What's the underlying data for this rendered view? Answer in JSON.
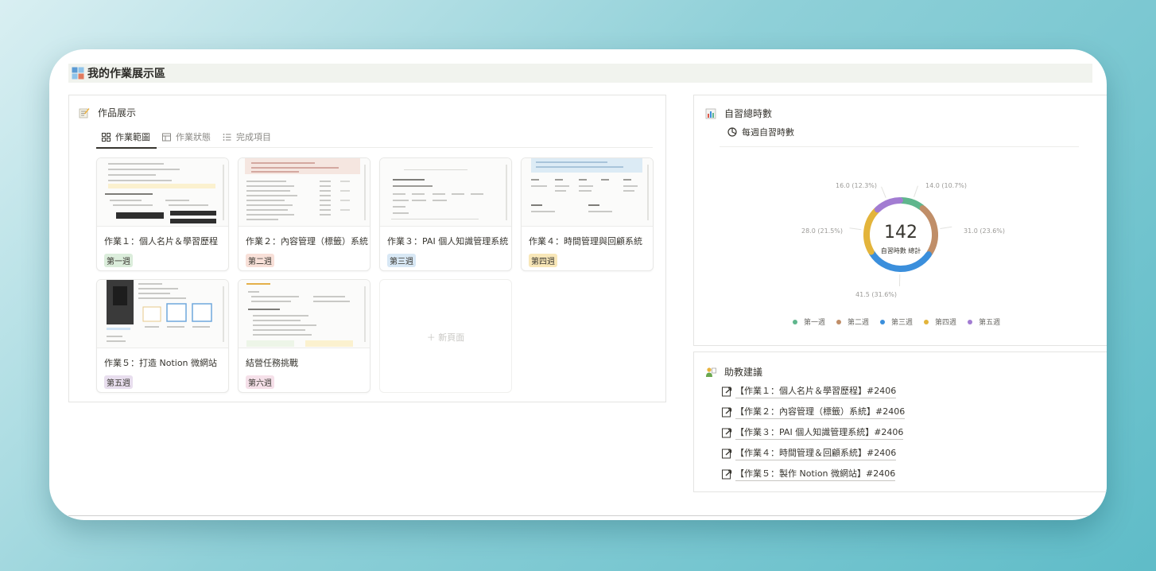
{
  "page": {
    "title": "我的作業展示區"
  },
  "works": {
    "title": "作品展示",
    "tabs": [
      {
        "label": "作業範圖",
        "active": true,
        "icon": "gallery-icon"
      },
      {
        "label": "作業狀態",
        "active": false,
        "icon": "table-icon"
      },
      {
        "label": "完成項目",
        "active": false,
        "icon": "list-icon"
      }
    ],
    "cards": [
      {
        "title": "作業１：個人名片＆學習歷程",
        "tag": "第一週",
        "tag_color": "#dbeddb"
      },
      {
        "title": "作業２：內容管理（標籤）系統",
        "tag": "第二週",
        "tag_color": "#f8e0d8"
      },
      {
        "title": "作業３：PAI 個人知識管理系統",
        "tag": "第三週",
        "tag_color": "#d8e8f5"
      },
      {
        "title": "作業４：時間管理與回顧系統",
        "tag": "第四週",
        "tag_color": "#f8e7b8"
      },
      {
        "title": "作業５：打造 Notion 微網站",
        "tag": "第五週",
        "tag_color": "#e8deee"
      },
      {
        "title": "結營任務挑戰",
        "tag": "第六週",
        "tag_color": "#f5e0e9"
      }
    ],
    "new_page": "＋ 新頁面"
  },
  "hours": {
    "title": "自習總時數",
    "subtab": "每週自習時數",
    "total": "142",
    "total_label": "自習時數 總計",
    "chart_data": {
      "type": "pie",
      "title": "",
      "categories": [
        "第一週",
        "第二週",
        "第三週",
        "第四週",
        "第五週"
      ],
      "values": [
        14.0,
        31.0,
        41.5,
        28.0,
        16.0
      ],
      "labels": [
        "14.0 (10.7%)",
        "31.0 (23.6%)",
        "41.5 (31.6%)",
        "28.0 (21.5%)",
        "16.0 (12.3%)"
      ],
      "colors": [
        "#5fb68d",
        "#c08e68",
        "#3b8fdc",
        "#e3b43b",
        "#a27cd2"
      ],
      "legend": "bottom"
    }
  },
  "advice": {
    "title": "助教建議",
    "links": [
      "【作業１：個人名片＆學習歷程】#2406",
      "【作業２：內容管理（標籤）系統】#2406",
      "【作業３：PAI 個人知識管理系統】#2406",
      "【作業４：時間管理＆回顧系統】#2406",
      "【作業５：製作 Notion 微網站】#2406"
    ]
  }
}
